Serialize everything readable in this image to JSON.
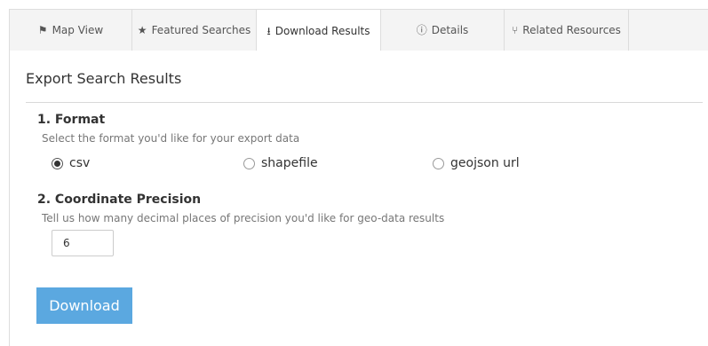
{
  "tabs": [
    {
      "icon": "map-marker-icon",
      "glyph": "⚑",
      "label": "Map View",
      "active": false
    },
    {
      "icon": "star-icon",
      "glyph": "★",
      "label": "Featured Searches",
      "active": false
    },
    {
      "icon": "download-icon",
      "glyph": "⭳",
      "label": "Download Results",
      "active": true
    },
    {
      "icon": "info-circle-icon",
      "glyph": "ⓘ",
      "label": "Details",
      "active": false
    },
    {
      "icon": "code-fork-icon",
      "glyph": "⑂",
      "label": "Related Resources",
      "active": false
    }
  ],
  "panel": {
    "title": "Export Search Results"
  },
  "format": {
    "heading": "1. Format",
    "help": "Select the format you'd like for your export data",
    "options": [
      {
        "label": "csv",
        "checked": true
      },
      {
        "label": "shapefile",
        "checked": false
      },
      {
        "label": "geojson url",
        "checked": false
      }
    ]
  },
  "precision": {
    "heading": "2. Coordinate Precision",
    "help": "Tell us how many decimal places of precision you'd like for geo-data results",
    "value": "6"
  },
  "download": {
    "label": "Download"
  },
  "colors": {
    "accent": "#5ba8e0",
    "tab_background": "#f4f4f4",
    "border": "#dddddd"
  }
}
